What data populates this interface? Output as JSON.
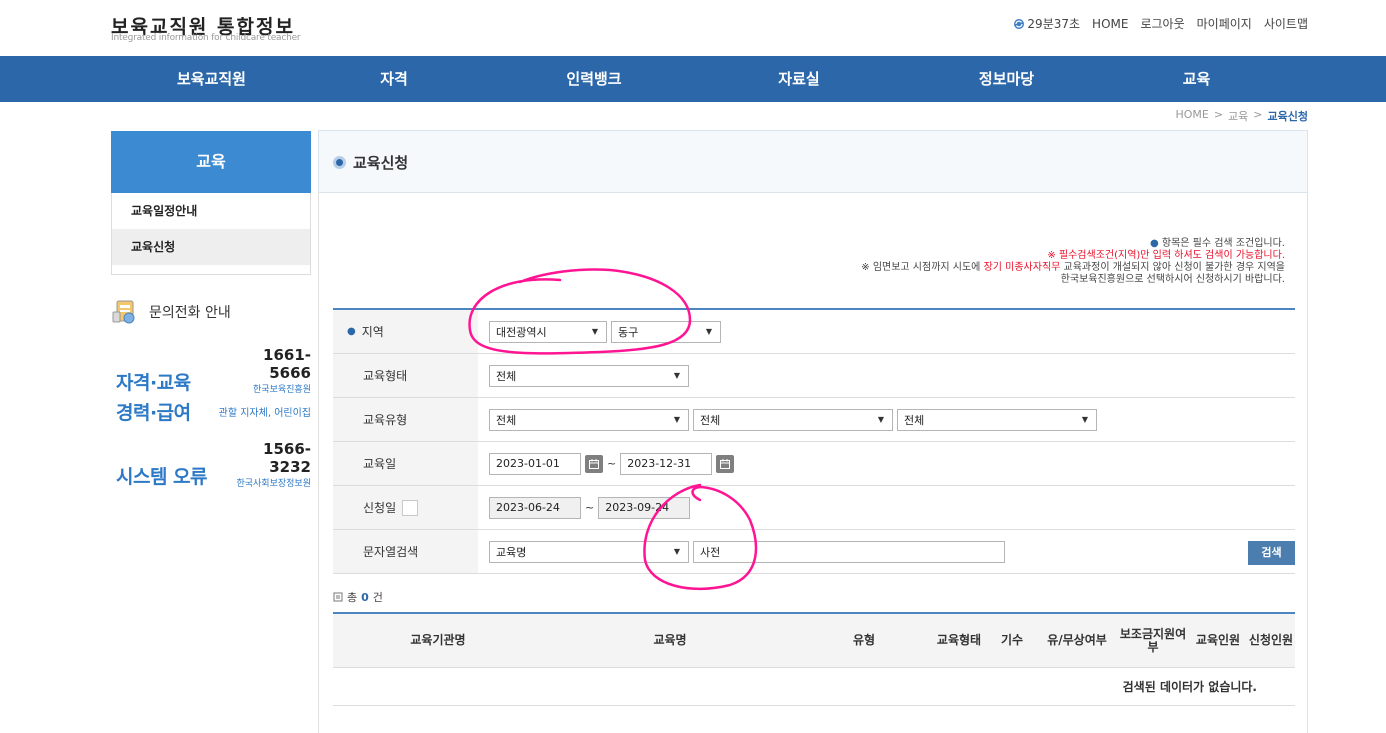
{
  "header": {
    "title": "보육교직원 통합정보",
    "subtitle": "Integrated information for childcare teacher",
    "timer": "29분37초",
    "links": [
      "HOME",
      "로그아웃",
      "마이페이지",
      "사이트맵"
    ]
  },
  "nav": [
    "보육교직원",
    "자격",
    "인력뱅크",
    "자료실",
    "정보마당",
    "교육"
  ],
  "breadcrumb": {
    "home": "HOME",
    "sep": ">",
    "level1": "교육",
    "current": "교육신청"
  },
  "sidebar": {
    "title": "교육",
    "items": [
      {
        "label": "교육일정안내",
        "active": false
      },
      {
        "label": "교육신청",
        "active": true
      }
    ],
    "contact_title": "문의전화 안내",
    "contacts": [
      {
        "label": "자격·교육",
        "number": "1661-5666",
        "org": "한국보육진흥원"
      },
      {
        "label": "경력·급여",
        "number": "",
        "org": "관할 지자체, 어린이집"
      },
      {
        "label": "시스템 오류",
        "number": "1566-3232",
        "org": "한국사회보장정보원"
      }
    ]
  },
  "page_title": "교육신청",
  "notice": {
    "line1_mark": "●",
    "line1": "항목은 필수 검색 조건입니다.",
    "line2": "※ 필수검색조건(지역)만 입력 하셔도 검색이 가능합니다.",
    "line3_a": "※ 임면보고 시점까지 시도에 ",
    "line3_red": "장기 미종사자직무",
    "line3_b": " 교육과정이 개설되지 않아 신청이 불가한 경우 지역을",
    "line4": "한국보육진흥원으로 선택하시어 신청하시기 바랍니다."
  },
  "form": {
    "region_label": "지역",
    "region_sido": "대전광역시",
    "region_gu": "동구",
    "type_label": "교육형태",
    "type_value": "전체",
    "kind_label": "교육유형",
    "kind_values": [
      "전체",
      "전체",
      "전체"
    ],
    "date_label": "교육일",
    "date_from": "2023-01-01",
    "date_sep": "~",
    "date_to": "2023-12-31",
    "apply_label": "신청일",
    "apply_from": "2023-06-24",
    "apply_to": "2023-09-24",
    "keyword_label": "문자열검색",
    "keyword_field": "교육명",
    "keyword_value": "사전",
    "search_button": "검색"
  },
  "results": {
    "count_prefix": "총",
    "count": "0",
    "count_suffix": "건",
    "columns": [
      "교육기관명",
      "교육명",
      "유형",
      "교육형태",
      "기수",
      "유/무상여부",
      "보조금지원여부",
      "교육인원",
      "신청인원"
    ],
    "empty_message": "검색된 데이터가 없습니다."
  },
  "colors": {
    "nav_bg": "#2c67a9",
    "sidebar_head": "#3c8ad1",
    "accent": "#2c79c6",
    "annotation": "#ff1493",
    "warning": "#e8102a"
  }
}
